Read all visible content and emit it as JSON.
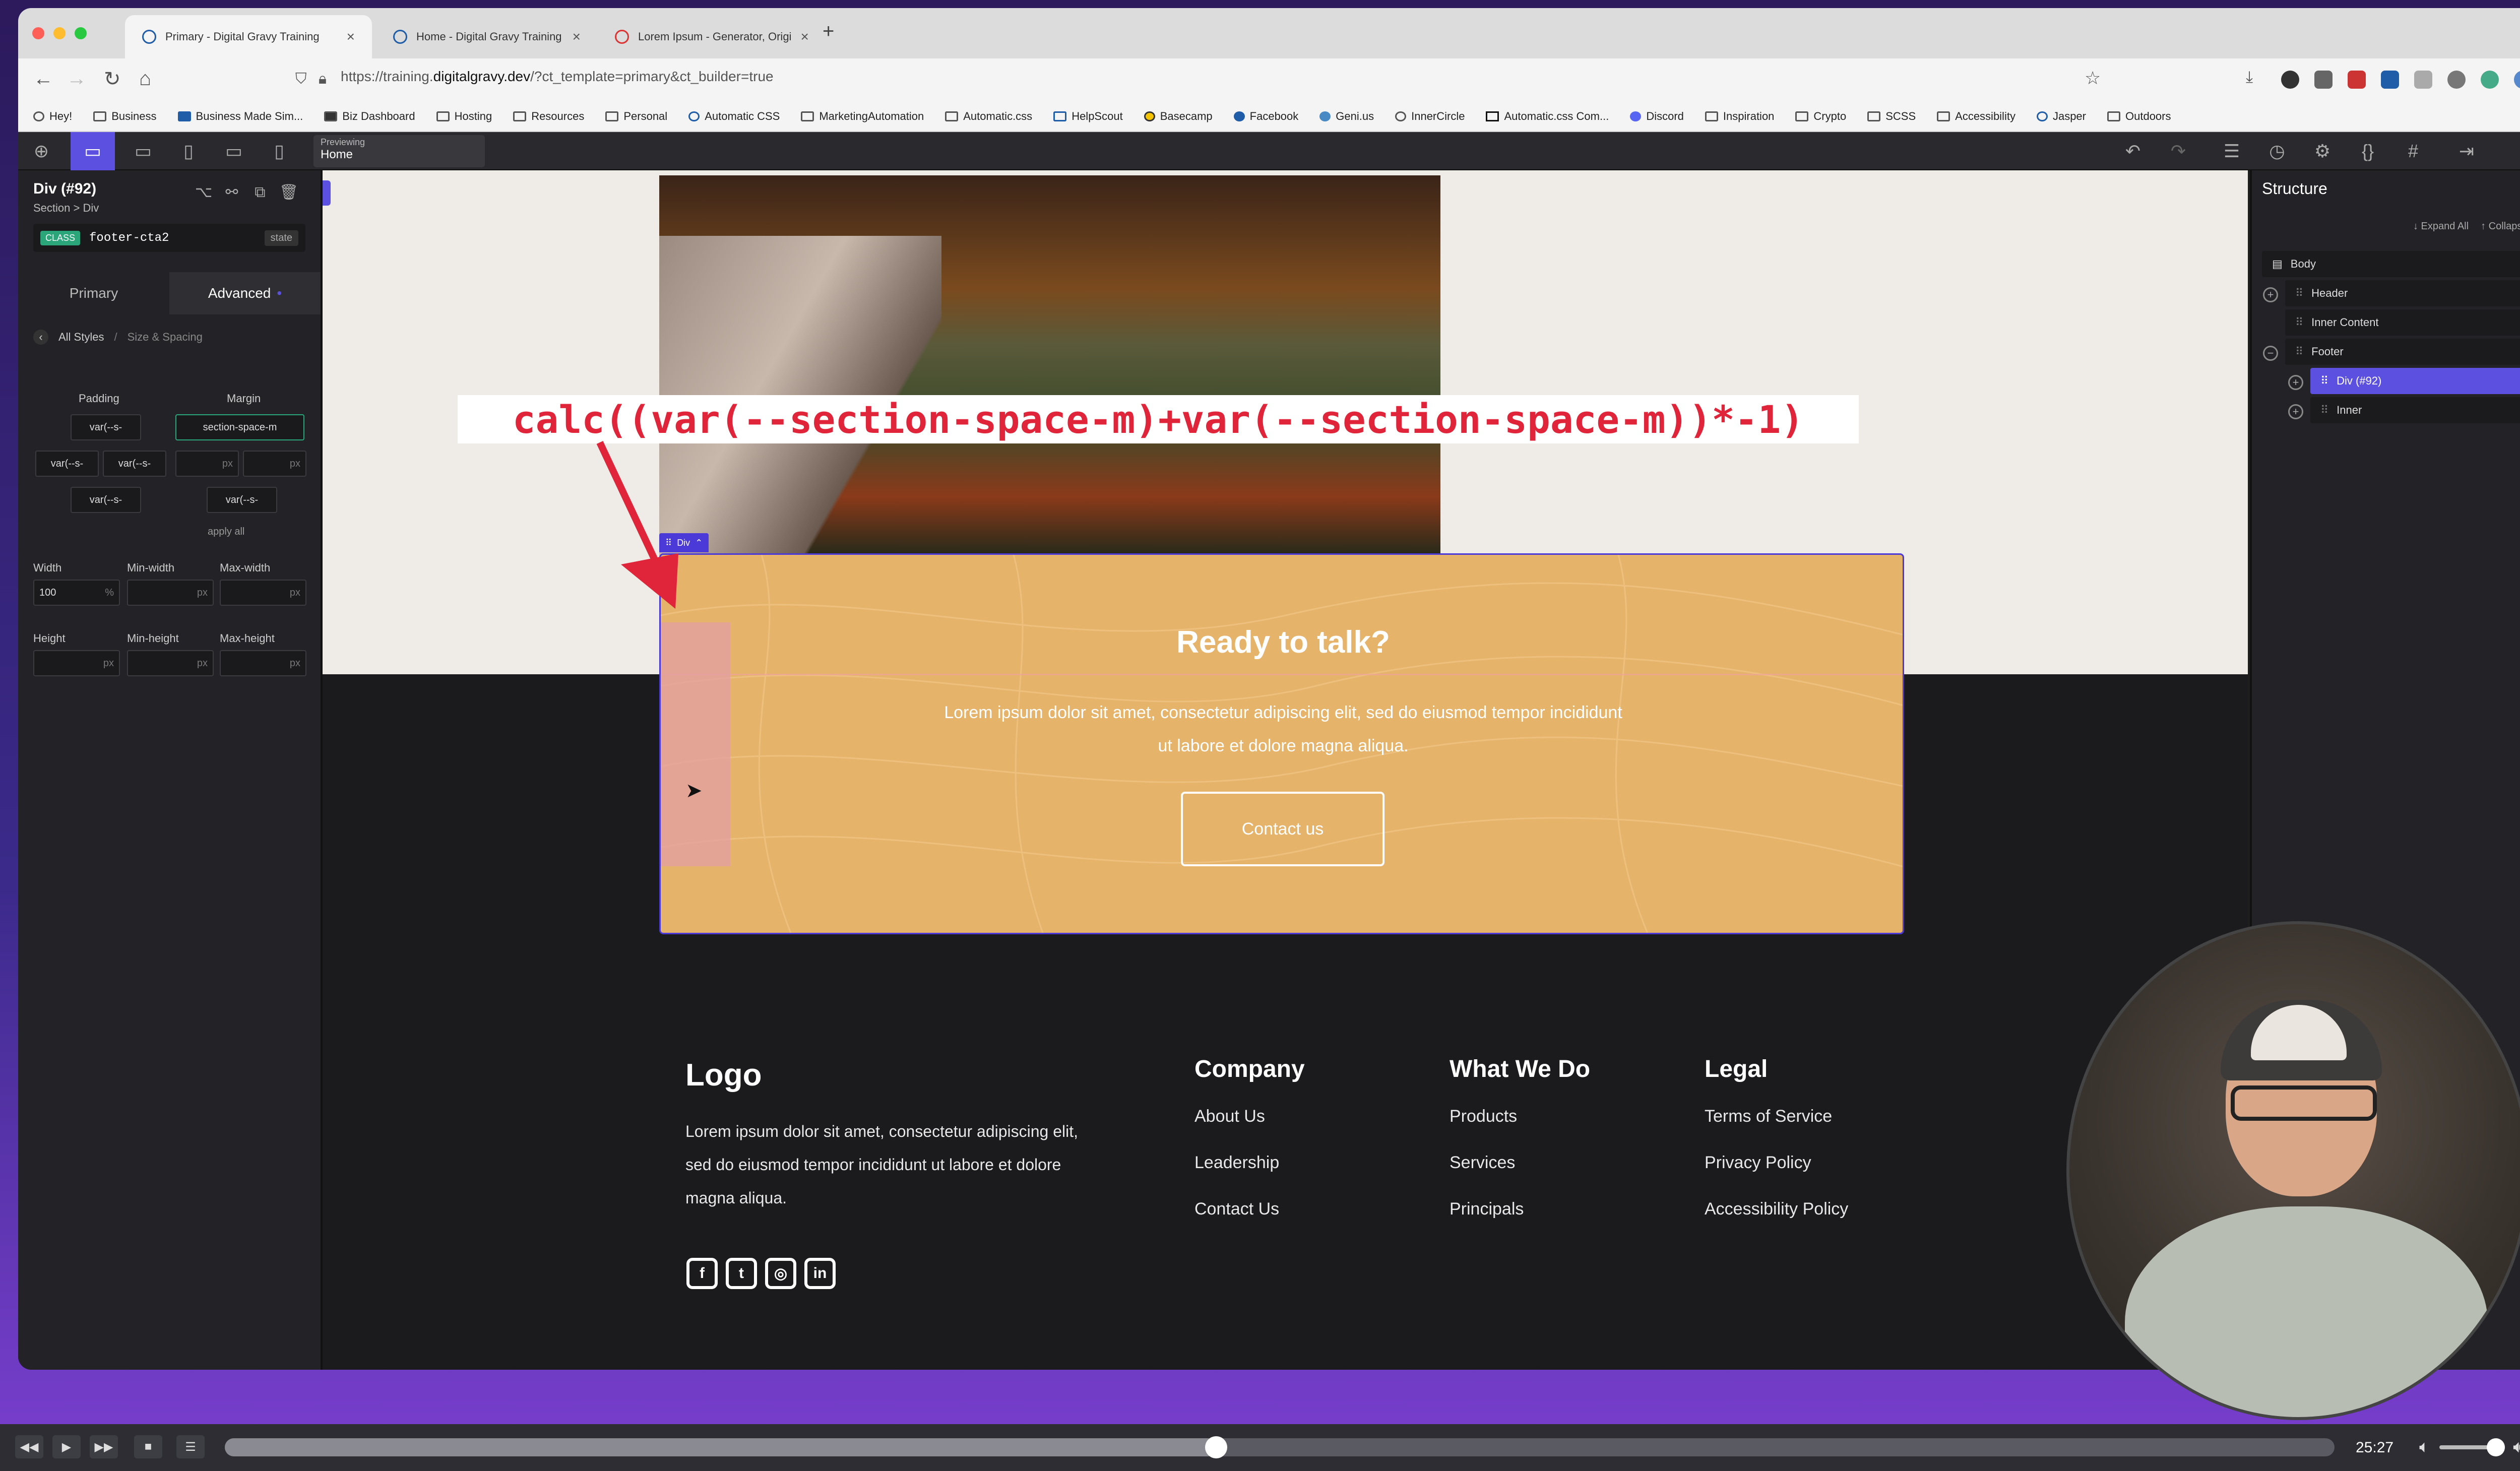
{
  "browser": {
    "tabs": [
      {
        "title": "Primary - Digital Gravy Training",
        "active": true
      },
      {
        "title": "Home - Digital Gravy Training",
        "active": false
      },
      {
        "title": "Lorem Ipsum - Generator, Origi",
        "active": false
      }
    ],
    "url_prefix": "https://training.",
    "url_domain": "digitalgravy.dev",
    "url_path": "/?ct_template=primary&ct_builder=true",
    "bookmarks": [
      "Hey!",
      "Business",
      "Business Made Sim...",
      "Biz Dashboard",
      "Hosting",
      "Resources",
      "Personal",
      "Automatic CSS",
      "MarketingAutomation",
      "Automatic.css",
      "HelpScout",
      "Basecamp",
      "Facebook",
      "Geni.us",
      "InnerCircle",
      "Automatic.css Com...",
      "Discord",
      "Inspiration",
      "Crypto",
      "SCSS",
      "Accessibility",
      "Jasper",
      "Outdoors"
    ]
  },
  "toolbar": {
    "previewing_label": "Previewing",
    "previewing_value": "Home"
  },
  "left_panel": {
    "element_name": "Div (#92)",
    "breadcrumb": "Section > Div",
    "class_tag": "CLASS",
    "class_name": "footer-cta2",
    "state_label": "state",
    "tab_primary": "Primary",
    "tab_advanced": "Advanced",
    "nav_all_styles": "All Styles",
    "nav_sep": "/",
    "nav_size_spacing": "Size & Spacing",
    "padding_label": "Padding",
    "margin_label": "Margin",
    "padding_top": "var(--s-",
    "padding_left": "var(--s-",
    "padding_right": "var(--s-",
    "padding_bottom": "var(--s-",
    "margin_top": "section-space-m",
    "margin_left_unit": "px",
    "margin_right_unit": "px",
    "margin_bottom": "var(--s-",
    "apply_all": "apply all",
    "width_label": "Width",
    "minwidth_label": "Min-width",
    "maxwidth_label": "Max-width",
    "width_value": "100",
    "width_unit": "%",
    "minwidth_unit": "px",
    "maxwidth_unit": "px",
    "height_label": "Height",
    "minheight_label": "Min-height",
    "maxheight_label": "Max-height",
    "height_unit": "px",
    "minheight_unit": "px",
    "maxheight_unit": "px"
  },
  "canvas": {
    "annotation": "calc((var(--section-space-m)+var(--section-space-m))*-1)",
    "div_label": "Div",
    "cta_title": "Ready to talk?",
    "cta_text": "Lorem ipsum dolor sit amet, consectetur adipiscing elit, sed do eiusmod tempor incididunt ut labore et dolore magna aliqua.",
    "cta_button": "Contact us",
    "footer_logo": "Logo",
    "footer_about": "Lorem ipsum dolor sit amet, consectetur adipiscing elit, sed do eiusmod tempor incididunt ut labore et dolore magna aliqua.",
    "columns": [
      {
        "heading": "Company",
        "links": [
          "About Us",
          "Leadership",
          "Contact Us"
        ]
      },
      {
        "heading": "What We Do",
        "links": [
          "Products",
          "Services",
          "Principals"
        ]
      },
      {
        "heading": "Legal",
        "links": [
          "Terms of Service",
          "Privacy Policy",
          "Accessibility Policy"
        ]
      }
    ],
    "social_icons": [
      "facebook-icon",
      "twitter-icon",
      "instagram-icon",
      "linkedin-icon"
    ]
  },
  "right_panel": {
    "title": "Structure",
    "expand_all": "↓ Expand All",
    "collapse_all": "↑ Collapse All",
    "tree": [
      "Body",
      "Header",
      "Inner Content",
      "Footer",
      "Div (#92)",
      "Inner"
    ]
  },
  "player": {
    "time": "25:27",
    "progress": 0.47
  },
  "colors": {
    "accent": "#5c50e0",
    "cta_bg": "#e6b36b",
    "annotation": "#e0253a",
    "footer_bg": "#1b1a1d"
  }
}
